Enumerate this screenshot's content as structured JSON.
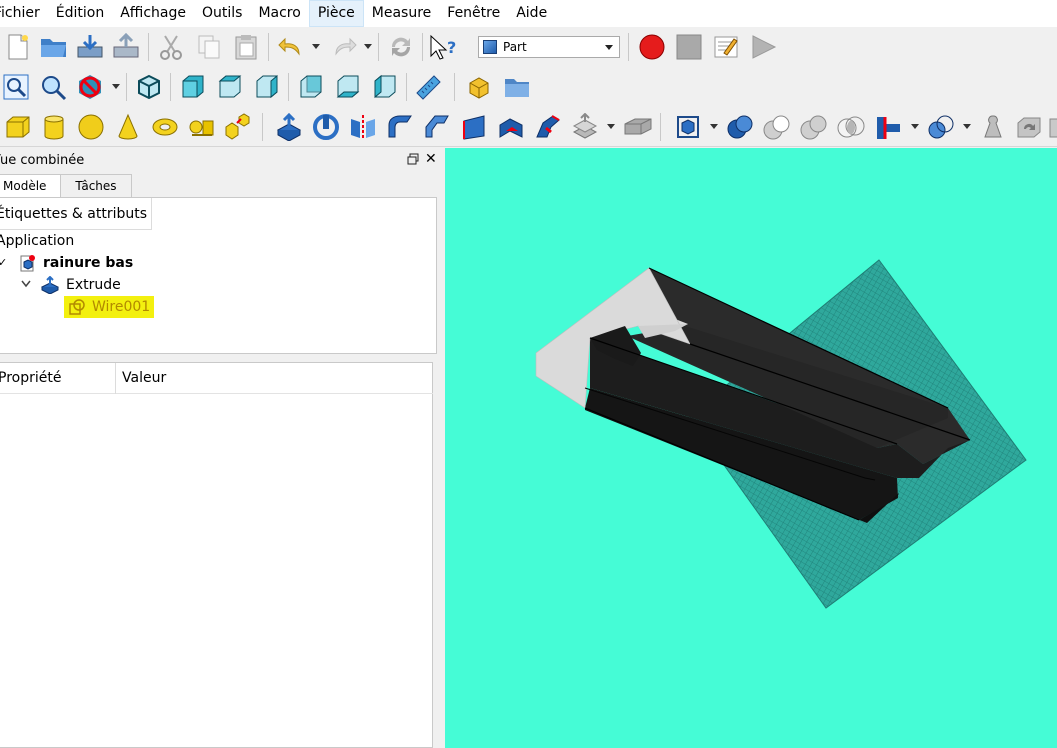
{
  "menu": {
    "items": [
      "Fichier",
      "Édition",
      "Affichage",
      "Outils",
      "Macro",
      "Pièce",
      "Measure",
      "Fenêtre",
      "Aide"
    ],
    "active": "Pièce"
  },
  "workbench_selector": {
    "value": "Part"
  },
  "combo_view": {
    "title": "Vue combinée"
  },
  "tabs": {
    "model": "Modèle",
    "tasks": "Tâches"
  },
  "tree": {
    "header": "Étiquettes & attributs",
    "root": "Application",
    "document": "rainure bas",
    "feature": "Extrude",
    "child": "Wire001"
  },
  "properties": {
    "col_property": "Propriété",
    "col_value": "Valeur"
  },
  "colors": {
    "viewport_bg": "#45fcd6",
    "highlight": "#f3f00f",
    "solid": "#1f1f1f",
    "face_light": "#dcdcdc"
  }
}
